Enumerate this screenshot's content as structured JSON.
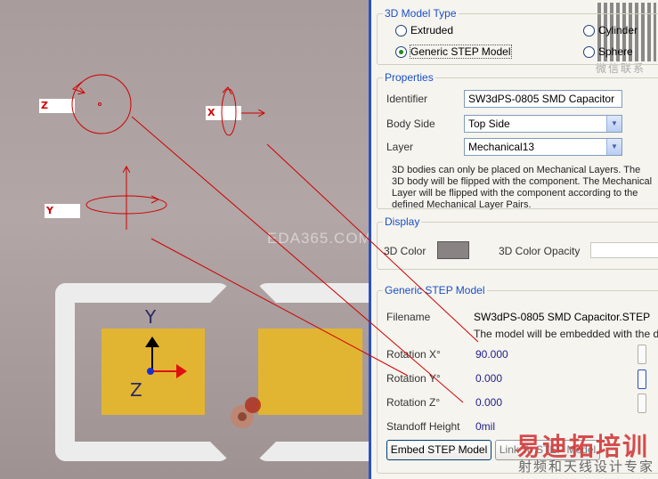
{
  "viewport": {
    "axis_labels": {
      "z": "Z",
      "x": "X",
      "y": "Y"
    },
    "axes_glyphs": {
      "y": "Y",
      "z": "Z"
    },
    "watermark": "EDA365.COM",
    "pad_color": "#e1b531"
  },
  "dialog": {
    "model_type": {
      "title": "3D Model Type",
      "options": [
        "Extruded",
        "Cylinder",
        "Generic STEP Model",
        "Sphere"
      ],
      "selected": "Generic STEP Model"
    },
    "properties": {
      "title": "Properties",
      "identifier_label": "Identifier",
      "identifier_value": "SW3dPS-0805 SMD Capacitor",
      "body_side_label": "Body Side",
      "body_side_value": "Top Side",
      "layer_label": "Layer",
      "layer_value": "Mechanical13",
      "note": "3D bodies can only be placed on Mechanical Layers. The 3D body will be flipped with the component. The Mechanical Layer will be flipped with the component according to the defined Mechanical Layer Pairs."
    },
    "display": {
      "title": "Display",
      "color_label": "3D Color",
      "color_value": "#8a8383",
      "opacity_label": "3D Color Opacity"
    },
    "generic_step": {
      "title": "Generic STEP Model",
      "filename_label": "Filename",
      "filename_value": "SW3dPS-0805 SMD Capacitor.STEP",
      "embed_note": "The model will be embedded with the document.",
      "rotation_x_label": "Rotation X°",
      "rotation_x_value": "90.000",
      "rotation_y_label": "Rotation Y°",
      "rotation_y_value": "0.000",
      "rotation_z_label": "Rotation Z°",
      "rotation_z_value": "0.000",
      "standoff_label": "Standoff Height",
      "standoff_value": "0mil",
      "embed_button": "Embed STEP Model",
      "link_button": "Link To STEP Model"
    }
  },
  "watermarks": {
    "wechat": "微信联系",
    "brand_cn": "易迪拓培训",
    "brand_sub": "射频和天线设计专家"
  }
}
